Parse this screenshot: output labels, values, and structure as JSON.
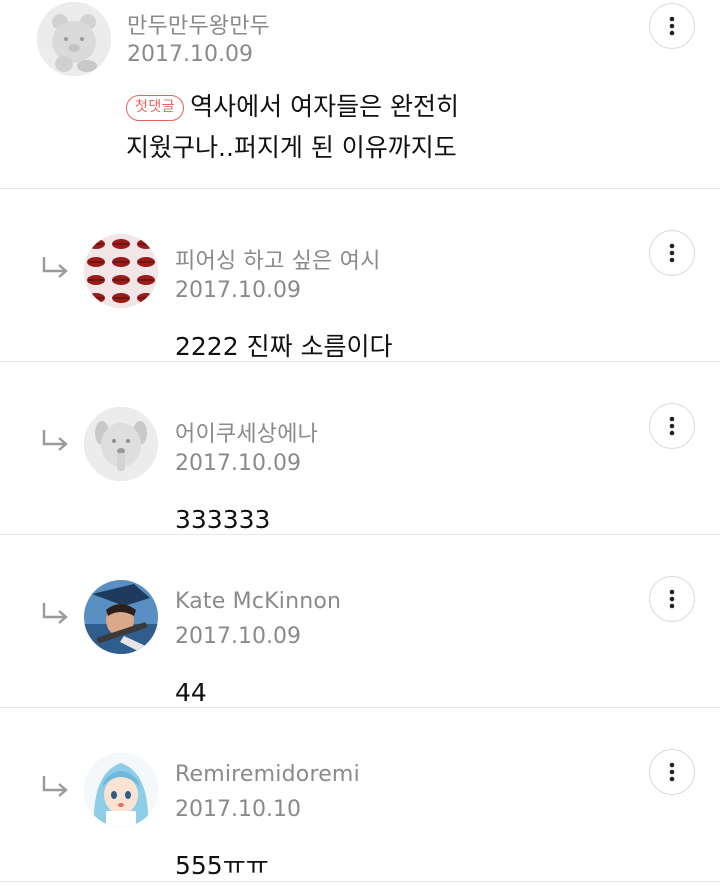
{
  "comments": [
    {
      "author": "만두만두왕만두",
      "date": "2017.10.09",
      "badge": "첫댓글",
      "text_line1": "역사에서 여자들은 완전히",
      "text_line2": "지웠구나..퍼지게 된 이유까지도",
      "avatar_icon": "bear-character-avatar",
      "menu_icon": "more-vertical-icon"
    },
    {
      "author": "피어싱 하고 싶은 여시",
      "date": "2017.10.09",
      "text": "2222 진짜 소름이다",
      "avatar_icon": "red-lips-pattern-avatar",
      "reply_icon": "reply-arrow-icon",
      "menu_icon": "more-vertical-icon"
    },
    {
      "author": "어이쿠세상에나",
      "date": "2017.10.09",
      "text": "333333",
      "avatar_icon": "dog-character-avatar",
      "reply_icon": "reply-arrow-icon",
      "menu_icon": "more-vertical-icon"
    },
    {
      "author": "Kate McKinnon",
      "date": "2017.10.09",
      "text": "44",
      "avatar_icon": "game-character-avatar",
      "reply_icon": "reply-arrow-icon",
      "menu_icon": "more-vertical-icon"
    },
    {
      "author": "Remiremidoremi",
      "date": "2017.10.10",
      "text": "555ㅠㅠ",
      "avatar_icon": "anime-girl-avatar",
      "reply_icon": "reply-arrow-icon",
      "menu_icon": "more-vertical-icon"
    }
  ],
  "colors": {
    "meta_text": "#8a8a8a",
    "body_text": "#111111",
    "badge": "#e8635c",
    "divider": "#e6e6e6"
  }
}
